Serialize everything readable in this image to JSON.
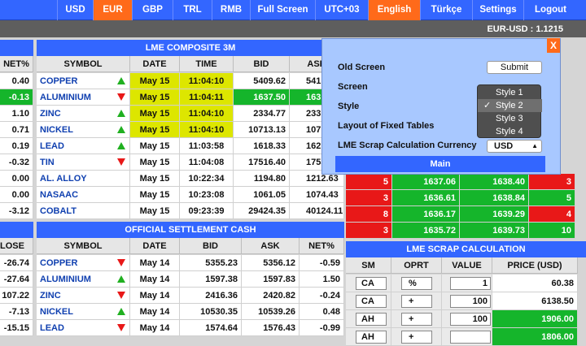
{
  "topnav": {
    "usd": "USD",
    "eur": "EUR",
    "gbp": "GBP",
    "trl": "TRL",
    "rmb": "RMB",
    "fullscreen": "Full Screen",
    "utc": "UTC+03",
    "english": "English",
    "turkce": "Türkçe",
    "settings": "Settings",
    "logout": "Logout"
  },
  "rate_label": "EUR-USD : 1.1215",
  "left_table": {
    "header": "NET%",
    "rows": [
      "0.40",
      "-0.13",
      "1.10",
      "0.71",
      "0.19",
      "-0.32",
      "0.00",
      "0.00",
      "-3.12"
    ]
  },
  "lme_composite": {
    "title": "LME COMPOSITE 3M",
    "headers": {
      "symbol": "SYMBOL",
      "date": "DATE",
      "time": "TIME",
      "bid": "BID",
      "ask": "ASK"
    },
    "rows": [
      {
        "symbol": "COPPER",
        "trend": "up",
        "date": "May 15",
        "time": "11:04:10",
        "bid": "5409.62",
        "ask": "541",
        "hl": true
      },
      {
        "symbol": "ALUMINIUM",
        "trend": "down",
        "date": "May 15",
        "time": "11:04:11",
        "bid": "1637.50",
        "ask": "163",
        "hl": true
      },
      {
        "symbol": "ZINC",
        "trend": "up",
        "date": "May 15",
        "time": "11:04:10",
        "bid": "2334.77",
        "ask": "233",
        "hl": true
      },
      {
        "symbol": "NICKEL",
        "trend": "up",
        "date": "May 15",
        "time": "11:04:10",
        "bid": "10713.13",
        "ask": "1071",
        "hl": true
      },
      {
        "symbol": "LEAD",
        "trend": "up",
        "date": "May 15",
        "time": "11:03:58",
        "bid": "1618.33",
        "ask": "162",
        "hl": false
      },
      {
        "symbol": "TIN",
        "trend": "down",
        "date": "May 15",
        "time": "11:04:08",
        "bid": "17516.40",
        "ask": "1755",
        "hl": false
      },
      {
        "symbol": "AL. ALLOY",
        "trend": "none",
        "date": "May 15",
        "time": "10:22:34",
        "bid": "1194.80",
        "ask": "1212.63",
        "hl": false
      },
      {
        "symbol": "NASAAC",
        "trend": "none",
        "date": "May 15",
        "time": "10:23:08",
        "bid": "1061.05",
        "ask": "1074.43",
        "hl": false
      },
      {
        "symbol": "COBALT",
        "trend": "none",
        "date": "May 15",
        "time": "09:23:39",
        "bid": "29424.35",
        "ask": "40124.11",
        "hl": false
      }
    ]
  },
  "settlement": {
    "title": "OFFICIAL SETTLEMENT CASH",
    "headers": {
      "close": "LOSE",
      "symbol": "SYMBOL",
      "date": "DATE",
      "bid": "BID",
      "ask": "ASK",
      "net": "NET%"
    },
    "rows": [
      {
        "close": "-26.74",
        "symbol": "COPPER",
        "trend": "down",
        "date": "May 14",
        "bid": "5355.23",
        "ask": "5356.12",
        "net": "-0.59"
      },
      {
        "close": "-27.64",
        "symbol": "ALUMINIUM",
        "trend": "up",
        "date": "May 14",
        "bid": "1597.38",
        "ask": "1597.83",
        "net": "1.50"
      },
      {
        "close": "107.22",
        "symbol": "ZINC",
        "trend": "down",
        "date": "May 14",
        "bid": "2416.36",
        "ask": "2420.82",
        "net": "-0.24"
      },
      {
        "close": "-7.13",
        "symbol": "NICKEL",
        "trend": "up",
        "date": "May 14",
        "bid": "10530.35",
        "ask": "10539.26",
        "net": "0.48"
      },
      {
        "close": "-15.15",
        "symbol": "LEAD",
        "trend": "down",
        "date": "May 14",
        "bid": "1574.64",
        "ask": "1576.43",
        "net": "-0.99"
      }
    ]
  },
  "right_table": {
    "rows": [
      {
        "a": "5",
        "b": "1637.06",
        "c": "1638.40",
        "d": "3",
        "dcolor": "red"
      },
      {
        "a": "3",
        "b": "1636.61",
        "c": "1638.84",
        "d": "5",
        "dcolor": "green"
      },
      {
        "a": "8",
        "b": "1636.17",
        "c": "1639.29",
        "d": "4",
        "dcolor": "red"
      },
      {
        "a": "3",
        "b": "1635.72",
        "c": "1639.73",
        "d": "10",
        "dcolor": "green"
      }
    ]
  },
  "scrap": {
    "title": "LME SCRAP CALCULATION",
    "headers": {
      "sm": "SM",
      "oprt": "OPRT",
      "value": "VALUE",
      "price": "PRICE (USD)"
    },
    "rows": [
      {
        "sm": "CA",
        "oprt": "%",
        "value": "1",
        "price": "60.38",
        "green": false
      },
      {
        "sm": "CA",
        "oprt": "+",
        "value": "100",
        "price": "6138.50",
        "green": false
      },
      {
        "sm": "AH",
        "oprt": "+",
        "value": "100",
        "price": "1906.00",
        "green": true
      },
      {
        "sm": "AH",
        "oprt": "+",
        "value": "",
        "price": "1806.00",
        "green": true
      }
    ]
  },
  "settings_dialog": {
    "close": "X",
    "old_screen": "Old Screen",
    "submit": "Submit",
    "screen": "Screen",
    "style": "Style",
    "layout": "Layout of Fixed Tables",
    "currency_label": "LME Scrap Calculation Currency",
    "currency_value": "USD",
    "style_options": [
      "Style 1",
      "Style 2",
      "Style 3",
      "Style 4"
    ],
    "style_selected": 1,
    "main_button": "Main"
  },
  "colors": {
    "nav_blue": "#3366ff",
    "active_orange": "#ff6a1a",
    "up_green": "#15b52b",
    "down_red": "#e81818",
    "highlight_yellow": "#dde600"
  }
}
